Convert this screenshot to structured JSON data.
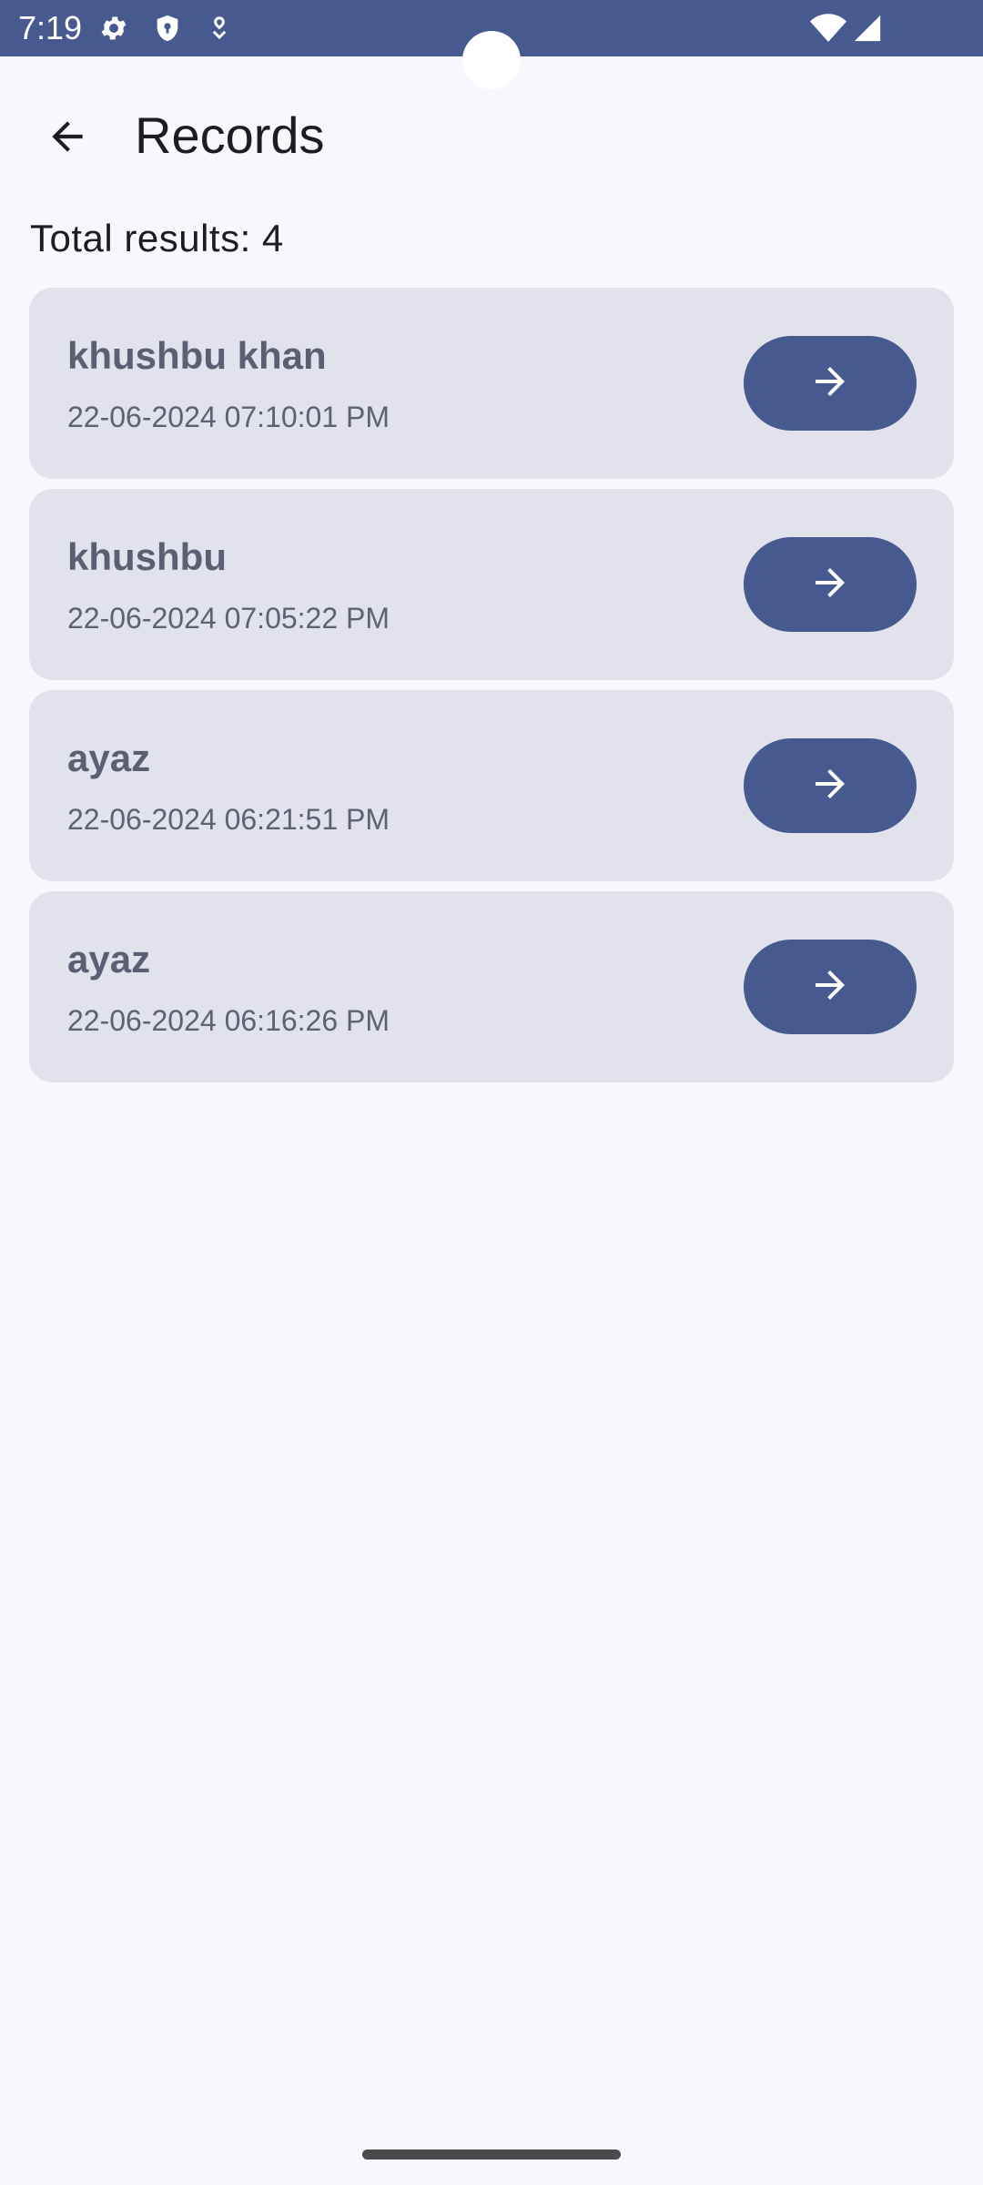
{
  "status_bar": {
    "time": "7:19",
    "background_color": "#465a8f",
    "left_icons": [
      "gear-icon",
      "shield-icon",
      "location-icon"
    ],
    "right_icons": [
      "wifi-icon",
      "signal-icon"
    ]
  },
  "app_bar": {
    "back_icon": "arrow-left-icon",
    "title": "Records"
  },
  "summary": {
    "total_results": "Total results: 4"
  },
  "records": [
    {
      "name": "khushbu khan",
      "date": "22-06-2024 07:10:01 PM",
      "action_icon": "arrow-right-icon"
    },
    {
      "name": "khushbu",
      "date": "22-06-2024 07:05:22 PM",
      "action_icon": "arrow-right-icon"
    },
    {
      "name": "ayaz",
      "date": "22-06-2024 06:21:51 PM",
      "action_icon": "arrow-right-icon"
    },
    {
      "name": "ayaz",
      "date": "22-06-2024 06:16:26 PM",
      "action_icon": "arrow-right-icon"
    }
  ],
  "colors": {
    "primary": "#465a8f",
    "card_background": "#e2e2ec",
    "page_background": "#f6f8fd"
  }
}
